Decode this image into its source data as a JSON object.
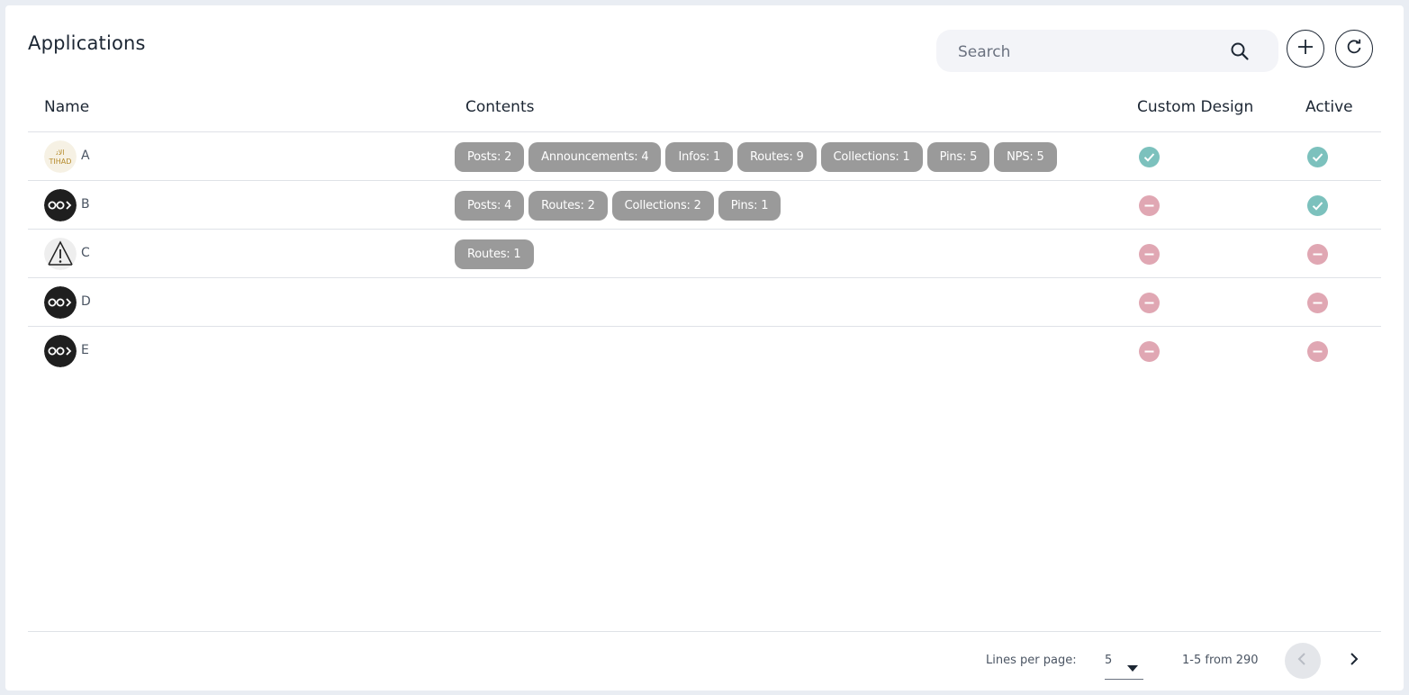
{
  "header": {
    "title": "Applications",
    "search_placeholder": "Search",
    "search_icon": "search-icon",
    "add_icon": "plus-icon",
    "refresh_icon": "refresh-icon"
  },
  "table": {
    "columns": [
      "Name",
      "Contents",
      "Custom Design",
      "Active"
    ],
    "rows": [
      {
        "name": "A",
        "avatar": "etihad-logo",
        "contents": [
          "Posts: 2",
          "Announcements: 4",
          "Infos: 1",
          "Routes: 9",
          "Collections: 1",
          "Pins: 5",
          "NPS: 5"
        ],
        "custom_design": true,
        "active": true
      },
      {
        "name": "B",
        "avatar": "app-default-logo",
        "contents": [
          "Posts: 4",
          "Routes: 2",
          "Collections: 2",
          "Pins: 1"
        ],
        "custom_design": false,
        "active": true
      },
      {
        "name": "C",
        "avatar": "warning-logo",
        "contents": [
          "Routes: 1"
        ],
        "custom_design": false,
        "active": false
      },
      {
        "name": "D",
        "avatar": "app-default-logo",
        "contents": [],
        "custom_design": false,
        "active": false
      },
      {
        "name": "E",
        "avatar": "app-default-logo",
        "contents": [],
        "custom_design": false,
        "active": false
      }
    ]
  },
  "pagination": {
    "lines_per_page_label": "Lines per page:",
    "lines_per_page_value": "5",
    "range_text": "1-5 from 290"
  },
  "colors": {
    "check": "#7cc1bd",
    "minus": "#e0a7b3",
    "chip": "#9a9a9a",
    "text": "#1c2633"
  }
}
